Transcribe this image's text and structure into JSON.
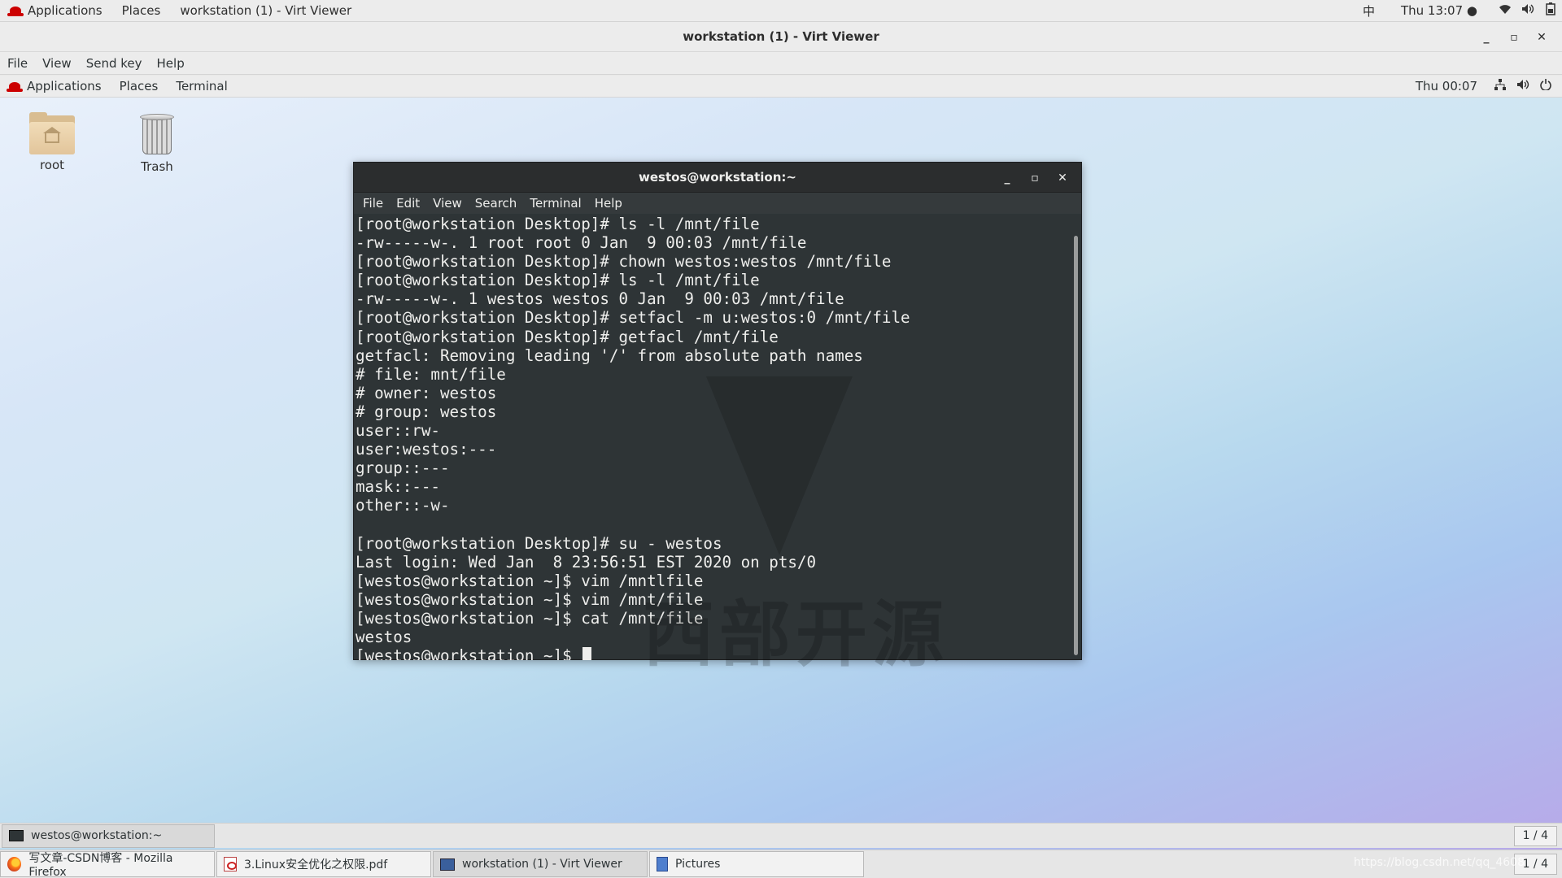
{
  "host_topbar": {
    "applications": "Applications",
    "places": "Places",
    "active_app": "workstation (1) - Virt Viewer",
    "input_method": "中",
    "clock": "Thu 13:07 ●"
  },
  "viewer": {
    "title": "workstation (1) - Virt Viewer",
    "menu": [
      "File",
      "View",
      "Send key",
      "Help"
    ]
  },
  "guest_topbar": {
    "applications": "Applications",
    "places": "Places",
    "terminal": "Terminal",
    "clock": "Thu 00:07"
  },
  "desktop_icons": [
    {
      "label": "root"
    },
    {
      "label": "Trash"
    }
  ],
  "terminal": {
    "title": "westos@workstation:~",
    "menu": [
      "File",
      "Edit",
      "View",
      "Search",
      "Terminal",
      "Help"
    ],
    "lines": [
      "[root@workstation Desktop]# ls -l /mnt/file",
      "-rw-----w-. 1 root root 0 Jan  9 00:03 /mnt/file",
      "[root@workstation Desktop]# chown westos:westos /mnt/file",
      "[root@workstation Desktop]# ls -l /mnt/file",
      "-rw-----w-. 1 westos westos 0 Jan  9 00:03 /mnt/file",
      "[root@workstation Desktop]# setfacl -m u:westos:0 /mnt/file",
      "[root@workstation Desktop]# getfacl /mnt/file",
      "getfacl: Removing leading '/' from absolute path names",
      "# file: mnt/file",
      "# owner: westos",
      "# group: westos",
      "user::rw-",
      "user:westos:---",
      "group::---",
      "mask::---",
      "other::-w-",
      "",
      "[root@workstation Desktop]# su - westos",
      "Last login: Wed Jan  8 23:56:51 EST 2020 on pts/0",
      "[westos@workstation ~]$ vim /mntlfile",
      "[westos@workstation ~]$ vim /mnt/file",
      "[westos@workstation ~]$ cat /mnt/file",
      "westos"
    ],
    "prompt": "[westos@workstation ~]$ ",
    "watermark": "西部开源"
  },
  "guest_taskbar": {
    "task": "westos@workstation:~",
    "pager": "1 / 4"
  },
  "host_taskbar": {
    "tasks": [
      "写文章-CSDN博客 - Mozilla Firefox",
      "3.Linux安全优化之权限.pdf",
      "workstation (1) - Virt Viewer",
      "Pictures"
    ],
    "pager": "1 / 4",
    "watermark_url": "https://blog.csdn.net/qq_4608"
  }
}
